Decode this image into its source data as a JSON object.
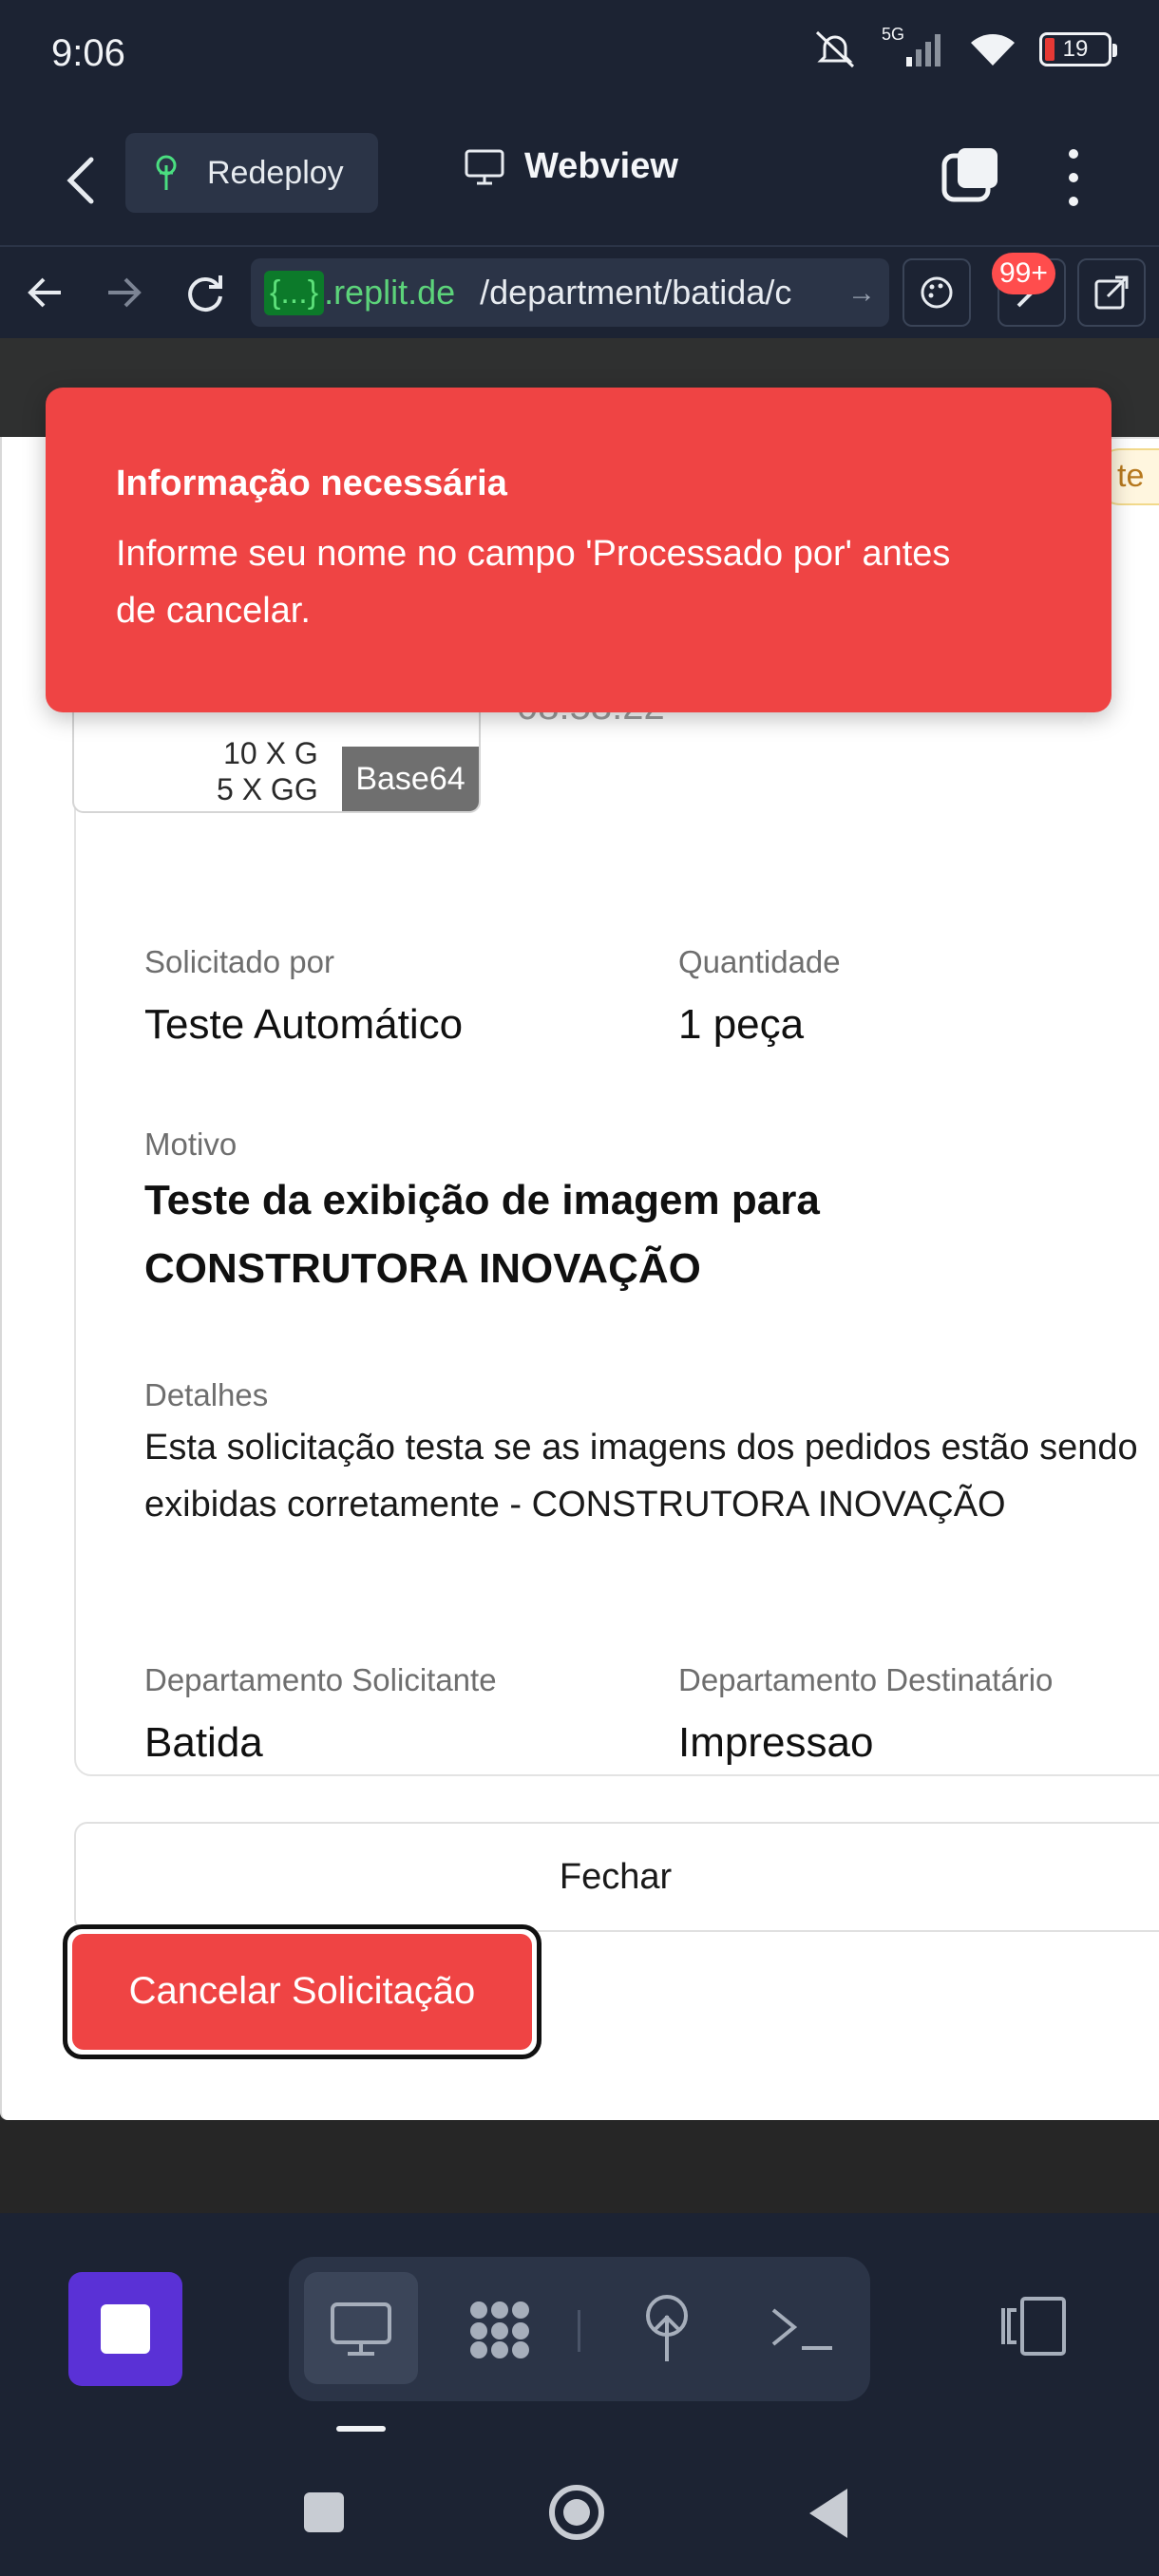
{
  "status": {
    "time": "9:06",
    "network": "5G",
    "battery": "19"
  },
  "header": {
    "back_label": "Back",
    "redeploy_label": "Redeploy",
    "webview_title": "Webview"
  },
  "urlbar": {
    "tag": "{...}",
    "domain": ".replit.de",
    "path": "/department/batida/c",
    "badge": "99+"
  },
  "page": {
    "chip_text": "te",
    "sizes": [
      "10 X G",
      "5 X GG"
    ],
    "base64_label": "Base64",
    "time": "08:53:22",
    "requested_by_label": "Solicitado por",
    "requested_by": "Teste Automático",
    "quantity_label": "Quantidade",
    "quantity": "1 peça",
    "reason_label": "Motivo",
    "reason": "Teste da exibição de imagem para CONSTRUTORA INOVAÇÃO",
    "details_label": "Detalhes",
    "details": "Esta solicitação testa se as imagens dos pedidos estão sendo exibidas corretamente - CONSTRUTORA INOVAÇÃO",
    "req_dept_label": "Departamento Solicitante",
    "req_dept": "Batida",
    "dest_dept_label": "Departamento Destinatário",
    "dest_dept": "Impressao",
    "close_label": "Fechar",
    "cancel_label": "Cancelar Solicitação"
  },
  "toast": {
    "title": "Informação necessária",
    "message": "Informe seu nome no campo 'Processado por' antes de cancelar.",
    "color": "#ef4444"
  },
  "dock": {
    "icons": [
      "stop-icon",
      "desktop-icon",
      "apps-icon",
      "deploy-icon",
      "terminal-icon",
      "layout-icon"
    ],
    "accent": "#5a31d6"
  }
}
